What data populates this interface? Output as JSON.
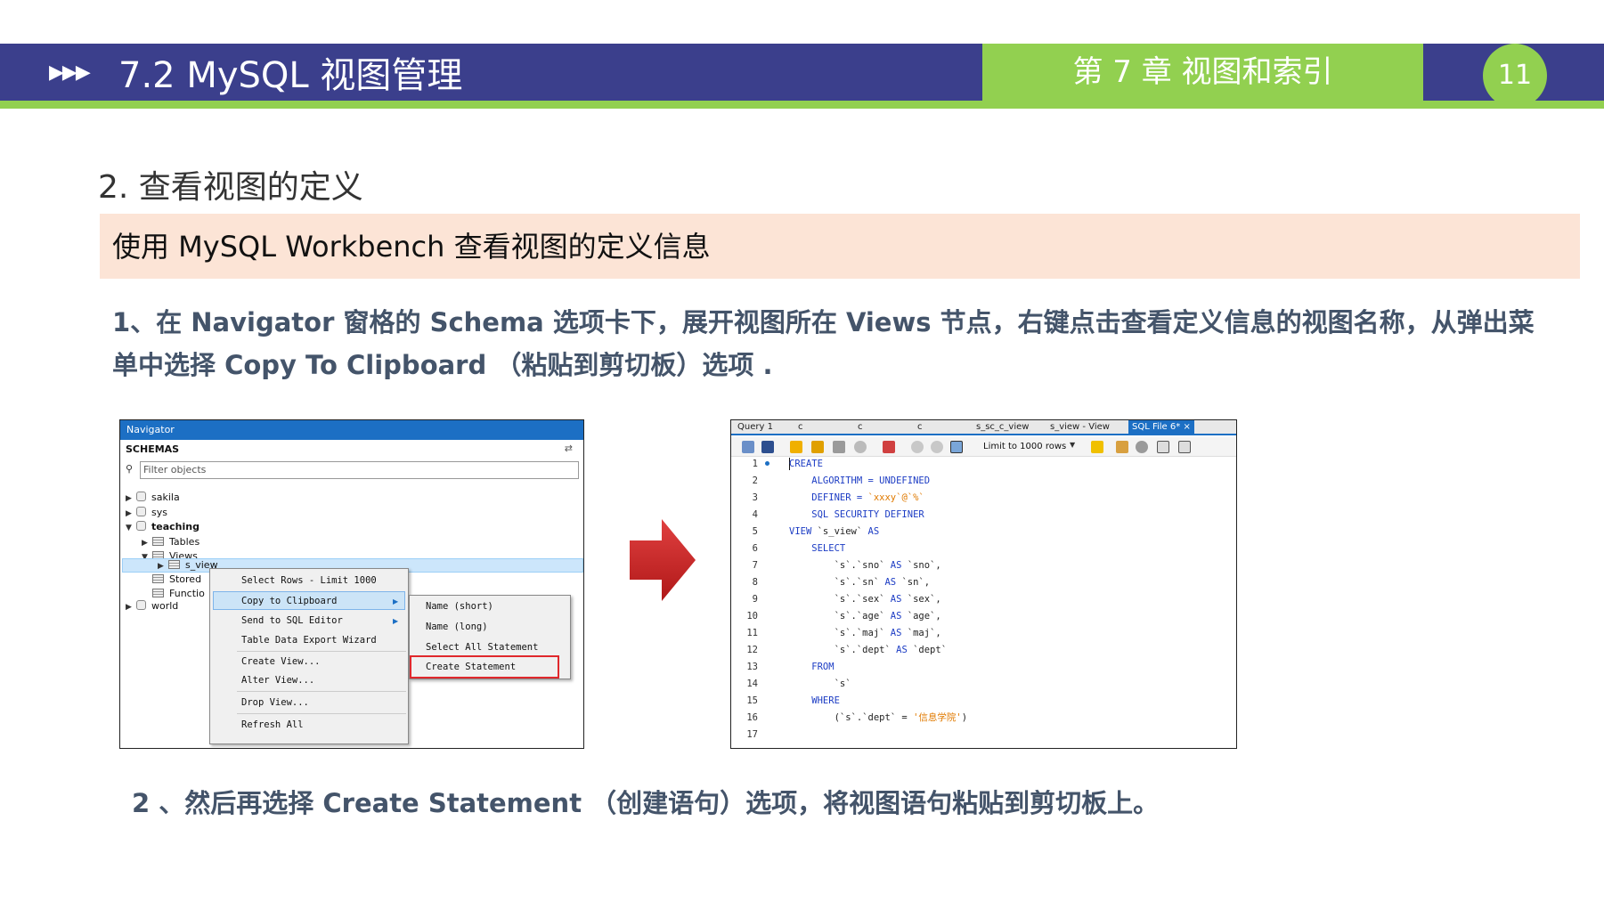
{
  "header": {
    "arrows": "▶▶▶",
    "title": "7.2  MySQL 视图管理",
    "chapter": "第 7 章  视图和索引",
    "page_number": "11"
  },
  "section": {
    "heading": "2.  查看视图的定义",
    "banner": "使用 MySQL Workbench 查看视图的定义信息",
    "step1": "1、在 Navigator 窗格的 Schema 选项卡下，展开视图所在 Views 节点，右键点击查看定义信息的视图名称，从弹出菜单中选择 Copy To Clipboard （粘贴到剪切板）选项 .",
    "step2": "2 、然后再选择 Create Statement （创建语句）选项，将视图语句粘贴到剪切板上。"
  },
  "navigator": {
    "title": "Navigator",
    "schemas_label": "SCHEMAS",
    "filter_placeholder": "Filter objects",
    "tree": {
      "sakila": "sakila",
      "sys": "sys",
      "teaching": "teaching",
      "tables": "Tables",
      "views": "Views",
      "s_view": "s_view",
      "stored": "Stored",
      "functions": "Functio",
      "world": "world"
    },
    "context_menu": [
      "Select Rows - Limit 1000",
      "Copy to Clipboard",
      "Send to SQL Editor",
      "Table Data Export Wizard",
      "Create View...",
      "Alter View...",
      "Drop View...",
      "Refresh All"
    ],
    "submenu": [
      "Name (short)",
      "Name (long)",
      "Select All Statement",
      "Create Statement"
    ]
  },
  "editor": {
    "tabs": [
      "Query 1",
      "c",
      "c",
      "c",
      "s_sc_c_view",
      "s_view - View",
      "SQL File 6*"
    ],
    "tab_close": "×",
    "limit_label": "Limit to 1000 rows",
    "line_numbers": [
      "1",
      "2",
      "3",
      "4",
      "5",
      "6",
      "7",
      "8",
      "9",
      "10",
      "11",
      "12",
      "13",
      "14",
      "15",
      "16",
      "17"
    ],
    "code": {
      "l1": "CREATE",
      "l2": "    ALGORITHM = UNDEFINED",
      "l3_kw": "    DEFINER = ",
      "l3_val": "`xxxy`@`%`",
      "l4": "    SQL SECURITY DEFINER",
      "l5_kw": "VIEW ",
      "l5_name": "`s_view`",
      "l5_as": " AS",
      "l6": "    SELECT",
      "l7_a": "        `s`.`sno`",
      "l7_b": " AS ",
      "l7_c": "`sno`,",
      "l8_a": "        `s`.`sn`",
      "l8_b": " AS ",
      "l8_c": "`sn`,",
      "l9_a": "        `s`.`sex`",
      "l9_b": " AS ",
      "l9_c": "`sex`,",
      "l10_a": "        `s`.`age`",
      "l10_b": " AS ",
      "l10_c": "`age`,",
      "l11_a": "        `s`.`maj`",
      "l11_b": " AS ",
      "l11_c": "`maj`,",
      "l12_a": "        `s`.`dept`",
      "l12_b": " AS ",
      "l12_c": "`dept`",
      "l13": "    FROM",
      "l14": "        `s`",
      "l15": "    WHERE",
      "l16_a": "        (`s`.`dept` = ",
      "l16_b": "'信息学院'",
      "l16_c": ")"
    }
  },
  "colors": {
    "header_blue": "#3b3f8c",
    "accent_green": "#92d050",
    "banner_peach": "#fce4d6",
    "step_text": "#44546a",
    "highlight_red": "#e0282c"
  }
}
